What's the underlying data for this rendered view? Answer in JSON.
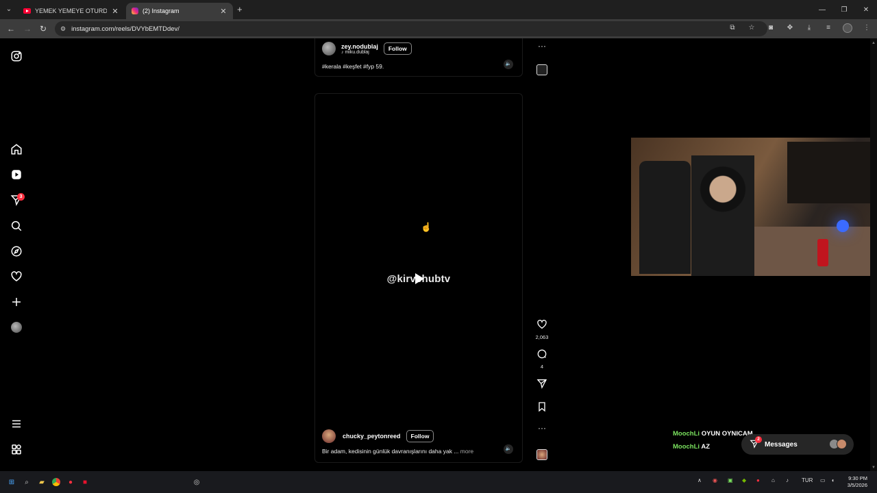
{
  "browser": {
    "tabs": [
      {
        "title": "YEMEK YEMEYE OTURDUK, AZ",
        "favicon": "youtube-icon",
        "active": false
      },
      {
        "title": "(2) Instagram",
        "favicon": "instagram-icon",
        "active": true
      }
    ],
    "url": "instagram.com/reels/DVYbEMTDdev/"
  },
  "instagram": {
    "notification_count": "3",
    "top_reel": {
      "username": "zey.nodublaj",
      "audio": "miku.dublaj",
      "follow_label": "Follow",
      "caption": "#kerala #keşfet #fyp 59."
    },
    "main_reel": {
      "watermark": "@kirvehubtv",
      "username": "chucky_peytonreed",
      "follow_label": "Follow",
      "caption": "Bir adam, kedisinin günlük davranışlarını daha yak ...",
      "more_label": "more",
      "likes": "2,063",
      "comments": "4"
    },
    "messages": {
      "label": "Messages",
      "badge": "2"
    }
  },
  "overlay_chat": [
    {
      "nick": "MoochLi",
      "message": "OYUN OYNICAM"
    },
    {
      "nick": "MoochLi",
      "message": "AZ"
    }
  ],
  "taskbar": {
    "language": "TUR",
    "time": "9:30 PM",
    "date": "3/5/2026"
  },
  "colors": {
    "accent_red": "#ff3040",
    "chat_nick": "#7be35f"
  }
}
